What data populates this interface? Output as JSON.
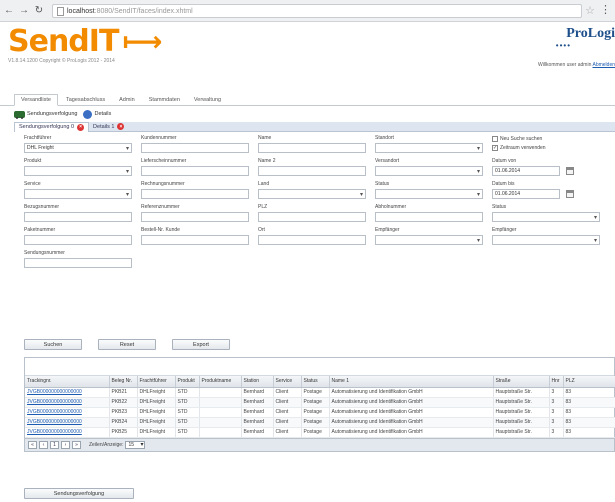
{
  "browser": {
    "url_prefix": "localhost",
    "url_suffix": ":8080/SendIT/faces/index.xhtml"
  },
  "header": {
    "logo_text": "SendIT",
    "version": "V1.8.14.1200 Copyright © ProLogis 2012 - 2014",
    "brand": "ProLogi",
    "login_text": "Willkommen user admin",
    "logout_label": "Abmelden"
  },
  "main_nav": [
    "Versandliste",
    "Tagesabschluss",
    "Admin",
    "Stammdaten",
    "Verwaltung"
  ],
  "toolbar": {
    "tracking_label": "Sendungsverfolgung",
    "settings_label": "Details"
  },
  "sub_tabs": [
    {
      "label": "Sendungsverfolgung 0"
    },
    {
      "label": "Details 1"
    }
  ],
  "form": {
    "frachtfuehrer": {
      "label": "Frachtführer",
      "value": "DHL Freight"
    },
    "produkt": {
      "label": "Produkt",
      "value": ""
    },
    "service": {
      "label": "Service",
      "value": ""
    },
    "bezugsnummer": {
      "label": "Bezugsnummer",
      "value": ""
    },
    "paketnummer": {
      "label": "Paketnummer",
      "value": ""
    },
    "sendungsnummer": {
      "label": "Sendungsnummer",
      "value": ""
    },
    "kundennummer": {
      "label": "Kundennummer",
      "value": ""
    },
    "lieferscheinnummer": {
      "label": "Lieferscheinnummer",
      "value": ""
    },
    "rechnungsnummer": {
      "label": "Rechnungsnummer",
      "value": ""
    },
    "referenznummer": {
      "label": "Referenznummer",
      "value": ""
    },
    "bestell_nr": {
      "label": "Bestell-Nr. Kunde",
      "value": ""
    },
    "name": {
      "label": "Name",
      "value": ""
    },
    "name2": {
      "label": "Name 2",
      "value": ""
    },
    "land": {
      "label": "Land",
      "value": ""
    },
    "plz": {
      "label": "PLZ",
      "value": ""
    },
    "ort": {
      "label": "Ort",
      "value": ""
    },
    "standort": {
      "label": "Standort",
      "value": ""
    },
    "versandort": {
      "label": "Versandort",
      "value": ""
    },
    "status": {
      "label": "Status",
      "value": ""
    },
    "abholnummer": {
      "label": "Abholnummer",
      "value": ""
    },
    "empfaenger": {
      "label": "Empfänger",
      "value": ""
    },
    "chk_suche_neu": {
      "label": "Neu Suche suchen",
      "checked": false
    },
    "chk_zeitraum": {
      "label": "Zeitraum verwenden",
      "checked": true
    },
    "datum_von": {
      "label": "Datum von",
      "value": "01.06.2014"
    },
    "datum_bis": {
      "label": "Datum bis",
      "value": "01.06.2014"
    },
    "status2": {
      "label": "Status",
      "value": ""
    },
    "empfaenger2": {
      "label": "Empfänger",
      "value": ""
    }
  },
  "buttons": {
    "search": "Suchen",
    "reset": "Reset",
    "export": "Export"
  },
  "grid": {
    "columns": [
      "Trackingnr.",
      "Beleg Nr.",
      "Frachtführer",
      "Produkt",
      "Produktname",
      "Station",
      "Service",
      "Status",
      "Name 1",
      "Straße",
      "Hnr",
      "PLZ"
    ],
    "rows": [
      [
        "JVGB000000000000000",
        "PKB21",
        "DHLFreight",
        "STD",
        "",
        "Bernhard",
        "Client",
        "Postage",
        "Automatisierung und Identifikation GmbH",
        "Hauptstraße Str.",
        "3",
        "83"
      ],
      [
        "JVGB000000000000000",
        "PKB22",
        "DHLFreight",
        "STD",
        "",
        "Bernhard",
        "Client",
        "Postage",
        "Automatisierung und Identifikation GmbH",
        "Hauptstraße Str.",
        "3",
        "83"
      ],
      [
        "JVGB000000000000000",
        "PKB23",
        "DHLFreight",
        "STD",
        "",
        "Bernhard",
        "Client",
        "Postage",
        "Automatisierung und Identifikation GmbH",
        "Hauptstraße Str.",
        "3",
        "83"
      ],
      [
        "JVGB000000000000000",
        "PKB24",
        "DHLFreight",
        "STD",
        "",
        "Bernhard",
        "Client",
        "Postage",
        "Automatisierung und Identifikation GmbH",
        "Hauptstraße Str.",
        "3",
        "83"
      ],
      [
        "JVGB000000000000000",
        "PKB25",
        "DHLFreight",
        "STD",
        "",
        "Bernhard",
        "Client",
        "Postage",
        "Automatisierung und Identifikation GmbH",
        "Hauptstraße Str.",
        "3",
        "83"
      ]
    ],
    "pager_label": "Zeilen/Anzeige:",
    "page_size": "15"
  },
  "bottom_button": "Sendungsverfolgung"
}
